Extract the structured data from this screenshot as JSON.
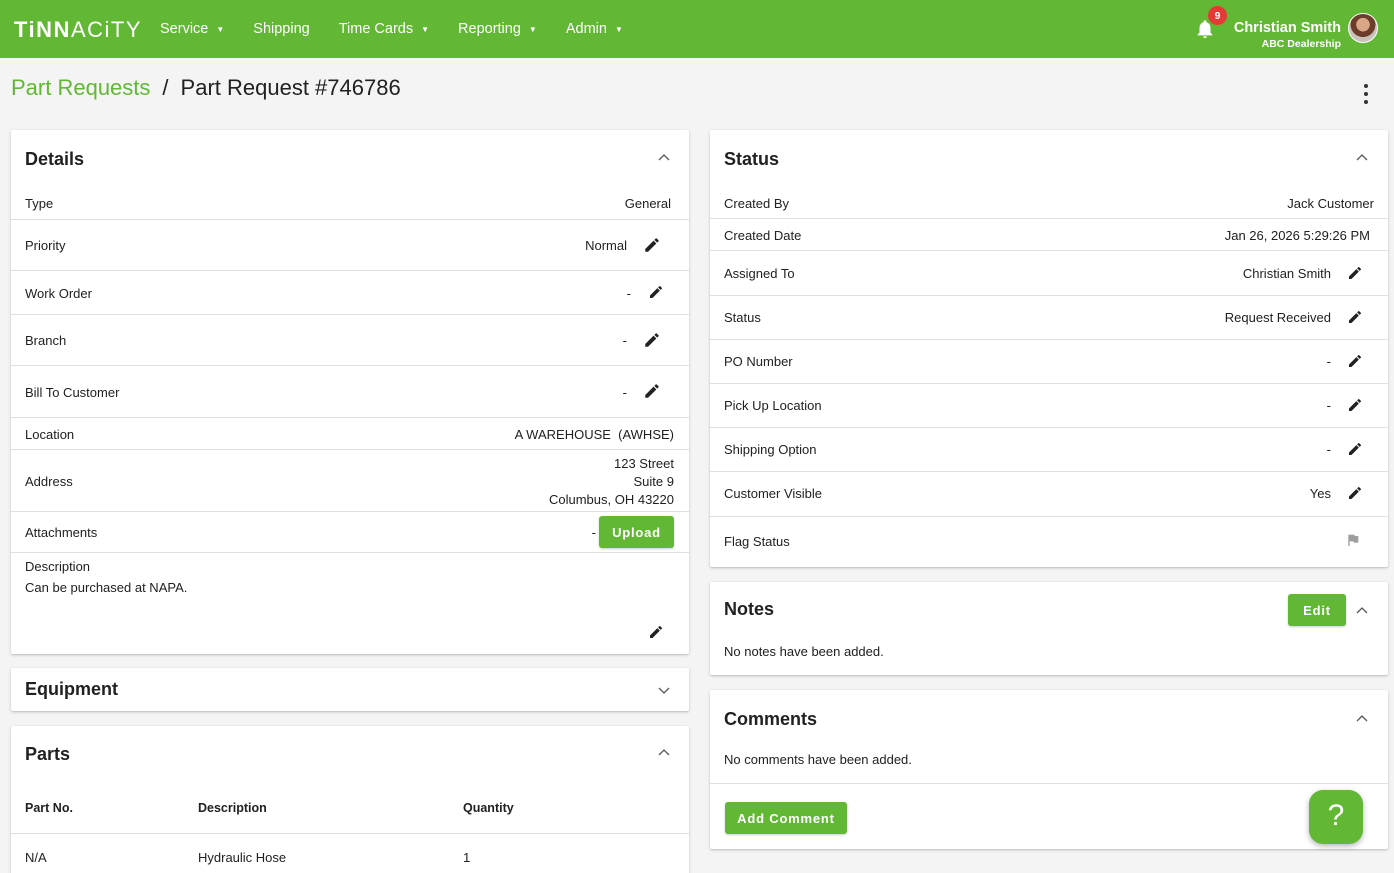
{
  "app": {
    "logo_a": "TiNN",
    "logo_b": "AC",
    "logo_c": "iTY",
    "nav": [
      {
        "label": "Service",
        "dropdown": true
      },
      {
        "label": "Shipping",
        "dropdown": false
      },
      {
        "label": "Time Cards",
        "dropdown": true
      },
      {
        "label": "Reporting",
        "dropdown": true
      },
      {
        "label": "Admin",
        "dropdown": true
      }
    ],
    "notifications_count": "9",
    "user_name": "Christian Smith",
    "user_org": "ABC Dealership",
    "accent_color": "#62b735"
  },
  "breadcrumb": {
    "parent": "Part Requests",
    "separator": "/",
    "current": "Part Request #746786"
  },
  "details": {
    "title": "Details",
    "rows": {
      "type": {
        "label": "Type",
        "value": "General"
      },
      "priority": {
        "label": "Priority",
        "value": "Normal"
      },
      "work_order": {
        "label": "Work Order",
        "value": "-"
      },
      "branch": {
        "label": "Branch",
        "value": "-"
      },
      "bill_to": {
        "label": "Bill To Customer",
        "value": "-"
      },
      "location": {
        "label": "Location",
        "value": "A WAREHOUSE  (AWHSE)"
      },
      "address": {
        "label": "Address",
        "line1": "123 Street",
        "line2": "Suite 9",
        "line3": "Columbus, OH 43220"
      },
      "attachments": {
        "label": "Attachments",
        "value": "-",
        "button": "Upload"
      },
      "description": {
        "label": "Description",
        "value": "Can be purchased at NAPA."
      }
    }
  },
  "equipment": {
    "title": "Equipment"
  },
  "parts": {
    "title": "Parts",
    "columns": [
      "Part No.",
      "Description",
      "Quantity"
    ],
    "rows": [
      {
        "part_no": "N/A",
        "description": "Hydraulic Hose",
        "quantity": "1"
      }
    ]
  },
  "status": {
    "title": "Status",
    "rows": {
      "created_by": {
        "label": "Created By",
        "value": "Jack Customer"
      },
      "created_date": {
        "label": "Created Date",
        "value": "Jan 26, 2026 5:29:26 PM"
      },
      "assigned_to": {
        "label": "Assigned To",
        "value": "Christian Smith"
      },
      "status": {
        "label": "Status",
        "value": "Request Received"
      },
      "po_number": {
        "label": "PO Number",
        "value": "-"
      },
      "pickup": {
        "label": "Pick Up Location",
        "value": "-"
      },
      "shipping": {
        "label": "Shipping Option",
        "value": "-"
      },
      "customer_visible": {
        "label": "Customer Visible",
        "value": "Yes"
      },
      "flag_status": {
        "label": "Flag Status",
        "icon": "flag-icon"
      }
    }
  },
  "notes": {
    "title": "Notes",
    "edit_label": "Edit",
    "empty": "No notes have been added."
  },
  "comments": {
    "title": "Comments",
    "empty": "No comments have been added.",
    "add_label": "Add Comment"
  },
  "help": {
    "label": "?"
  }
}
